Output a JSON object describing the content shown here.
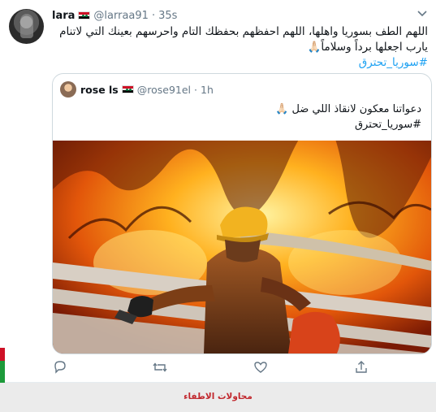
{
  "tweet": {
    "display_name": "lara",
    "handle": "@larraa91",
    "separator": "·",
    "time": "35s",
    "text": "اللهم الطف بسوريا واهلها، اللهم احفظهم بحفظك التام واحرسهم بعينك التي لاتنام يارب اجعلها برداً وسلاماً🙏🏻",
    "hashtag": "#سوريا_تحترق"
  },
  "quoted_tweet": {
    "display_name": "rose ls",
    "handle": "@rose91el",
    "separator": "·",
    "time": "1h",
    "text": "دعواتنا معكون  لانقاذ اللي ضل 🙏🏻",
    "hashtag": "#سوريا_تحترق"
  },
  "actions": {
    "icons": [
      "reply-icon",
      "retweet-icon",
      "like-icon",
      "share-icon"
    ]
  },
  "footer": {
    "link_text": "محاولات الاطفاء",
    "link_color": "#c1272d"
  },
  "colors": {
    "hashtag": "#1da1f2",
    "muted": "#657786",
    "border": "#cfd9de"
  }
}
